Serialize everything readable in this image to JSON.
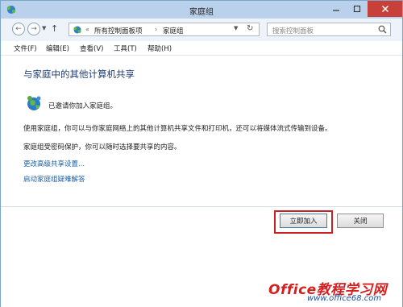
{
  "window": {
    "title": "家庭组"
  },
  "nav": {
    "breadcrumb": [
      "所有控制面板项",
      "家庭组"
    ],
    "breadcrumb_prefix": "«",
    "breadcrumb_sep": "›",
    "search_placeholder": "搜索控制面板"
  },
  "menu": [
    "文件(F)",
    "编辑(E)",
    "查看(V)",
    "工具(T)",
    "帮助(H)"
  ],
  "content": {
    "heading": "与家庭中的其他计算机共享",
    "status": "已邀请你加入家庭组。",
    "para1": "使用家庭组，你可以与你家庭网络上的其他计算机共享文件和打印机，还可以将媒体流式传输到设备。",
    "para2": "家庭组受密码保护，你可以随时选择要共享的内容。",
    "links": [
      "更改高级共享设置...",
      "启动家庭组疑难解答"
    ]
  },
  "buttons": {
    "join": "立即加入",
    "close": "关闭"
  },
  "watermark": {
    "main": "Office教程学习网",
    "url": "www.office68.com"
  },
  "colors": {
    "titlebar": "#b9d1ea",
    "close_button": "#c7403a",
    "heading": "#1e3e7b",
    "link": "#1a5ea6",
    "highlight": "#cc1f1f"
  }
}
